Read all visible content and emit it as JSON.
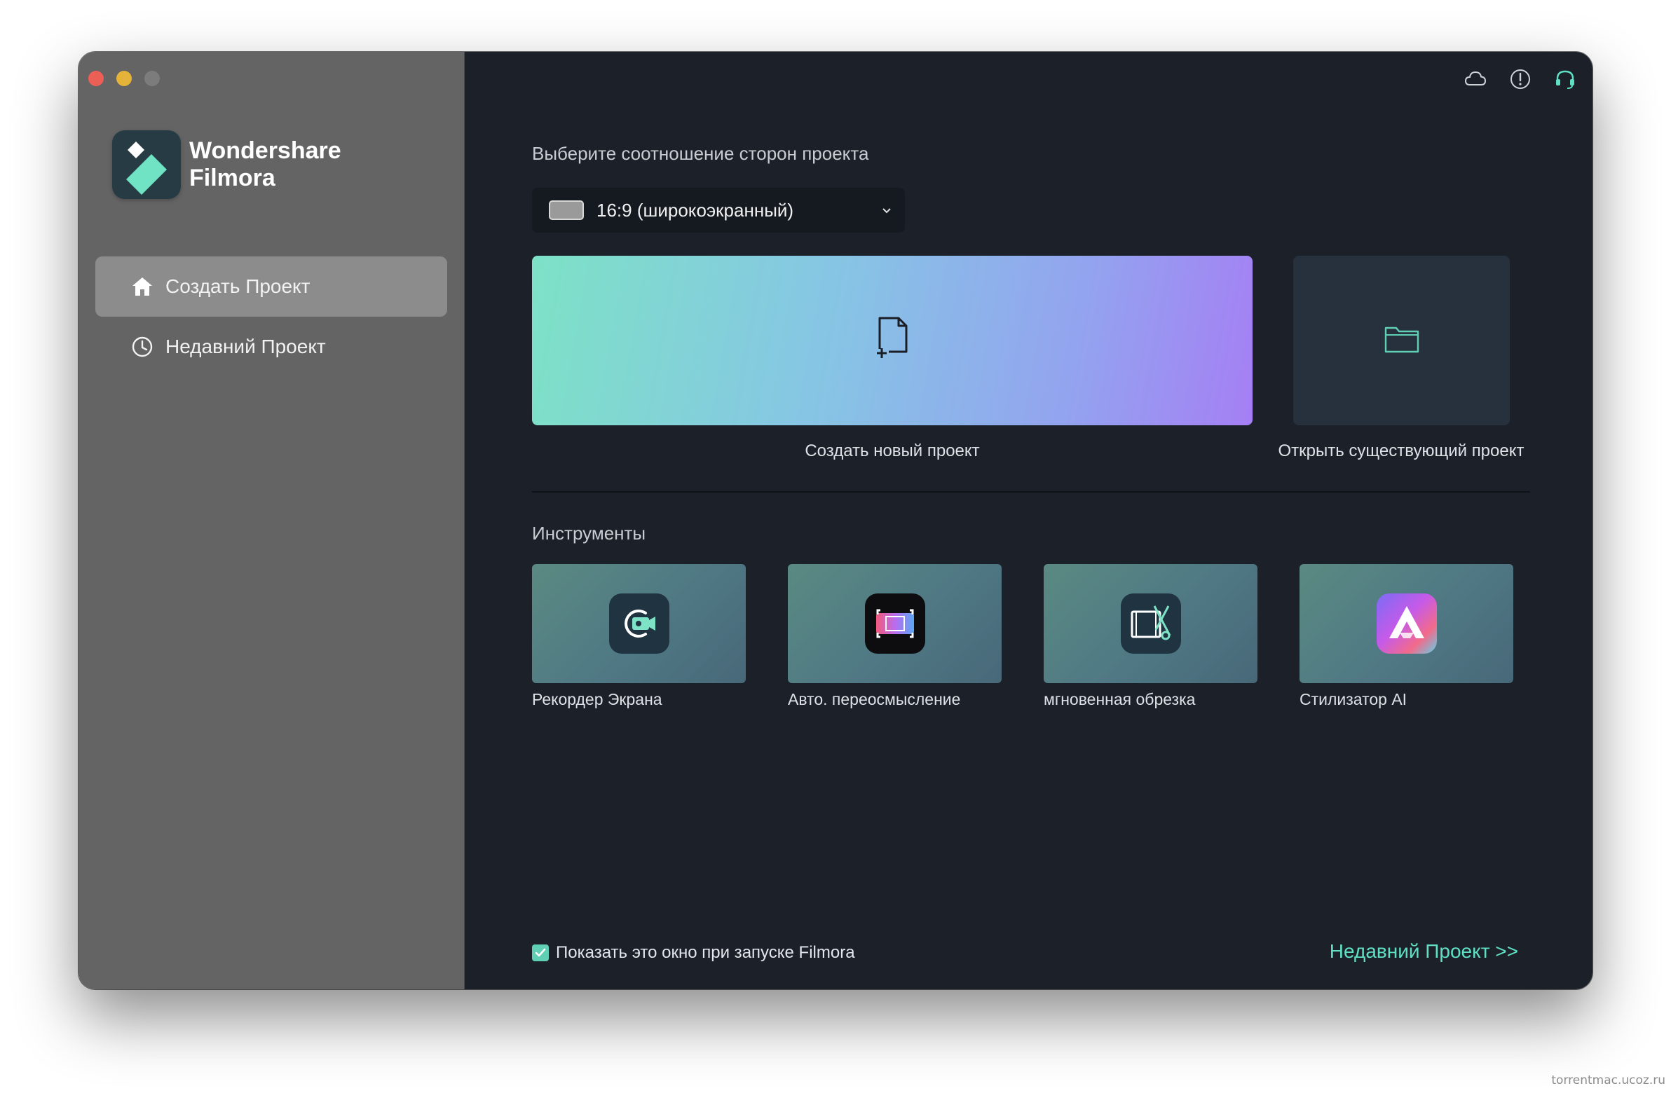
{
  "app": {
    "brand_line1": "Wondershare",
    "brand_line2": "Filmora"
  },
  "sidebar": {
    "items": [
      {
        "label": "Создать Проект",
        "icon": "home-icon",
        "active": true
      },
      {
        "label": "Недавний Проект",
        "icon": "clock-icon",
        "active": false
      }
    ]
  },
  "header": {
    "icons": [
      "cloud-icon",
      "info-icon",
      "headset-icon"
    ]
  },
  "main": {
    "aspect_title": "Выберите соотношение сторон проекта",
    "aspect_value": "16:9 (широкоэкранный)",
    "new_project_label": "Создать новый проект",
    "open_project_label": "Открыть существующий проект",
    "tools_title": "Инструменты",
    "tools": [
      {
        "label": "Рекордер Экрана",
        "icon": "screen-recorder-icon"
      },
      {
        "label": "Авто. переосмысление",
        "icon": "auto-reframe-icon"
      },
      {
        "label": "мгновенная обрезка",
        "icon": "instant-cutter-icon"
      },
      {
        "label": "Стилизатор AI",
        "icon": "ai-stylizer-icon"
      }
    ],
    "startup_checkbox_label": "Показать это окно при запуске Filmora",
    "startup_checked": true,
    "recent_link": "Недавний Проект >>"
  },
  "watermark": "torrentmac.ucoz.ru",
  "colors": {
    "accent": "#5fe0c4",
    "sidebar_bg": "#646464",
    "main_bg": "#1c2129"
  }
}
